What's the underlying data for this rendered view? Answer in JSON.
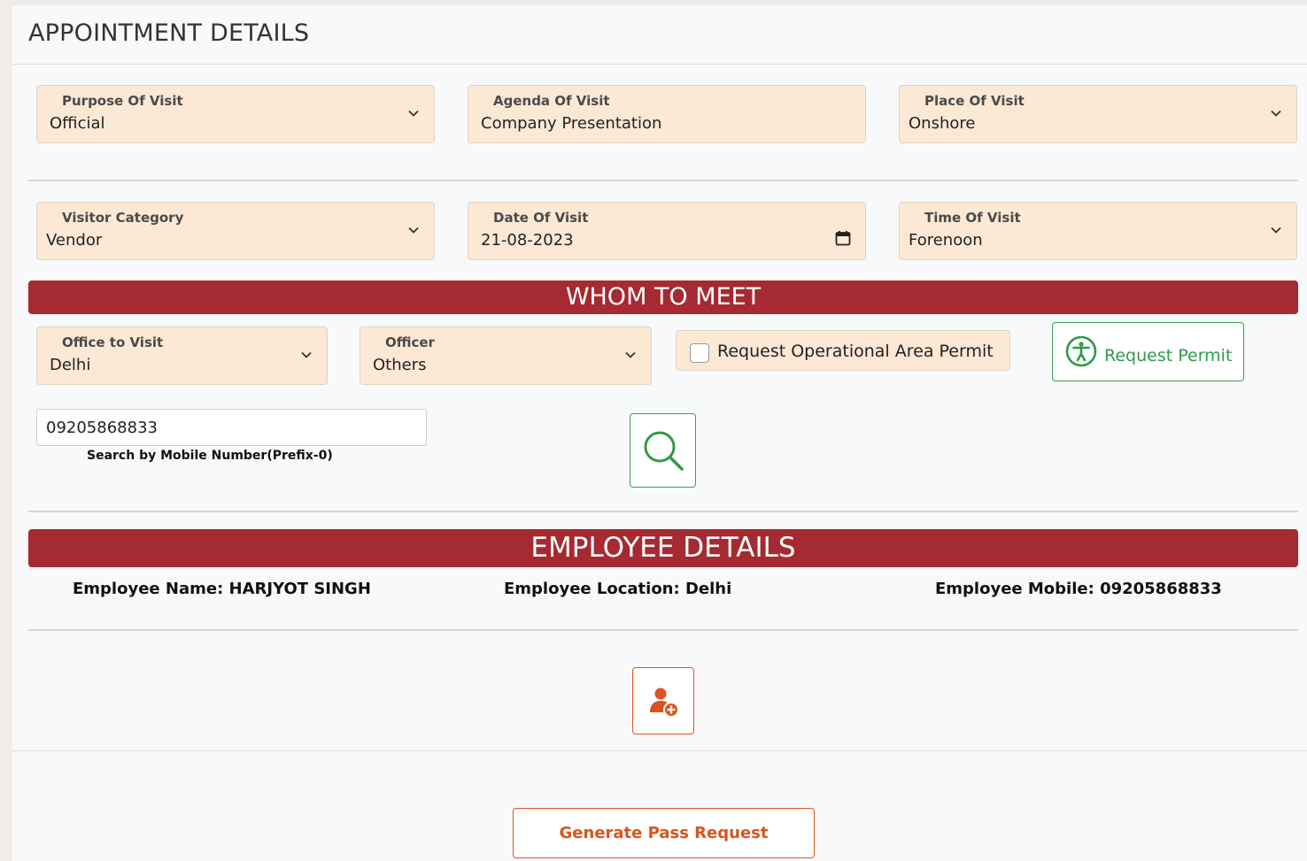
{
  "header": {
    "title": "APPOINTMENT DETAILS"
  },
  "appointment": {
    "purpose": {
      "label": "Purpose Of Visit",
      "value": "Official"
    },
    "agenda": {
      "label": "Agenda Of Visit",
      "value": "Company Presentation"
    },
    "place": {
      "label": "Place Of Visit",
      "value": "Onshore"
    },
    "visitor_category": {
      "label": "Visitor Category",
      "value": "Vendor"
    },
    "date": {
      "label": "Date Of Visit",
      "value": "21-08-2023"
    },
    "time": {
      "label": "Time Of Visit",
      "value": "Forenoon"
    }
  },
  "whom_to_meet": {
    "banner": "WHOM TO MEET",
    "office": {
      "label": "Office to Visit",
      "value": "Delhi"
    },
    "officer": {
      "label": "Officer",
      "value": "Others"
    },
    "permit_checkbox_label": "Request Operational Area Permit",
    "permit_checkbox_checked": false,
    "request_permit_label": "Request Permit",
    "mobile_value": "09205868833",
    "mobile_hint": "Search by Mobile Number(Prefix-0)"
  },
  "employee": {
    "banner": "EMPLOYEE DETAILS",
    "name_text": "Employee Name: HARJYOT SINGH",
    "location_text": "Employee Location: Delhi",
    "mobile_text": "Employee Mobile: 09205868833"
  },
  "footer": {
    "generate_label": "Generate Pass Request"
  },
  "colors": {
    "banner": "#a52a31",
    "field_bg": "#fbe9d5",
    "green_accent": "#2f9a49",
    "orange_accent": "#d9541e"
  },
  "icons": {
    "dropdown": "chevron-down-icon",
    "date": "calendar-icon",
    "permit": "accessibility-icon",
    "search": "search-icon",
    "add": "add-user-icon"
  }
}
